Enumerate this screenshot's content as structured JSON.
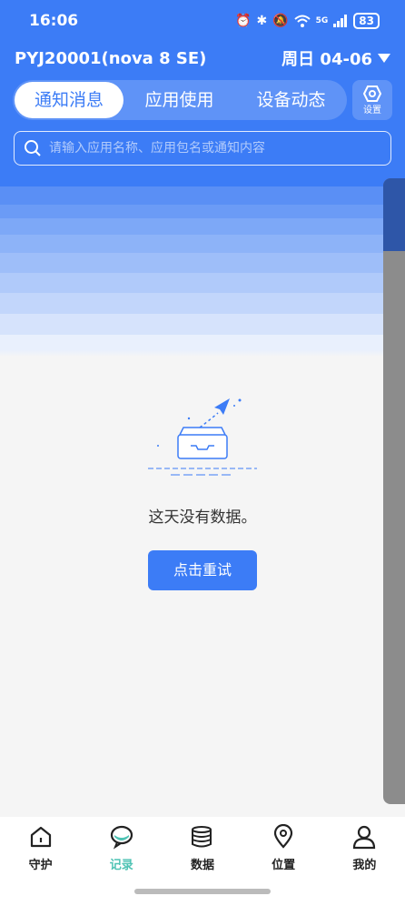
{
  "status_bar": {
    "time": "16:06",
    "signal_label": "5G",
    "battery": "83"
  },
  "header": {
    "device_name": "PYJ20001(nova 8 SE)",
    "date_label": "周日 04-06"
  },
  "tabs": [
    {
      "label": "通知消息",
      "active": true
    },
    {
      "label": "应用使用",
      "active": false
    },
    {
      "label": "设备动态",
      "active": false
    }
  ],
  "settings": {
    "label": "设置"
  },
  "search": {
    "placeholder": "请输入应用名称、应用包名或通知内容"
  },
  "empty_state": {
    "message": "这天没有数据。",
    "retry_label": "点击重试"
  },
  "bottom_nav": [
    {
      "label": "守护",
      "icon": "home-icon",
      "active": false
    },
    {
      "label": "记录",
      "icon": "chat-bubble-icon",
      "active": true
    },
    {
      "label": "数据",
      "icon": "database-icon",
      "active": false
    },
    {
      "label": "位置",
      "icon": "location-pin-icon",
      "active": false
    },
    {
      "label": "我的",
      "icon": "user-icon",
      "active": false
    }
  ],
  "colors": {
    "brand": "#3c7cf6",
    "active_nav": "#4fc3b4"
  }
}
